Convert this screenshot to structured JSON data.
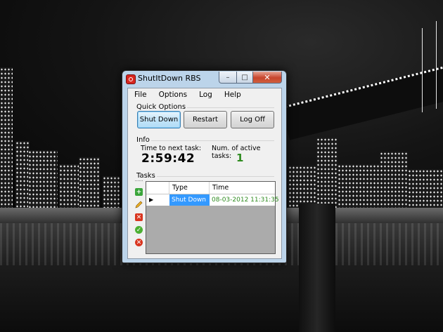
{
  "window": {
    "title": "ShutItDown RBS",
    "controls": {
      "minimize": "–",
      "maximize": "□",
      "close": "✕"
    }
  },
  "menu": [
    "File",
    "Options",
    "Log",
    "Help"
  ],
  "quick_options": {
    "label": "Quick Options",
    "buttons": [
      "Shut Down",
      "Restart",
      "Log Off"
    ]
  },
  "info": {
    "label": "Info",
    "time_label": "Time to next task:",
    "time_value": "2:59:42",
    "active_label": "Num. of active tasks:",
    "active_value": "1",
    "active_color": "#2e8b1f"
  },
  "tasks": {
    "label": "Tasks",
    "columns": [
      "Type",
      "Time"
    ],
    "rows": [
      {
        "selected_marker": "▶",
        "type": "Shut Down",
        "time": "08-03-2012 11:31:35"
      }
    ],
    "toolbar_icons": [
      "add-icon",
      "edit-pencil-icon",
      "delete-icon",
      "enable-check-icon",
      "disable-x-icon"
    ]
  },
  "colors": {
    "selection": "#3399ff",
    "time_text": "#2e8b1f",
    "close_button": "#c7442c"
  }
}
